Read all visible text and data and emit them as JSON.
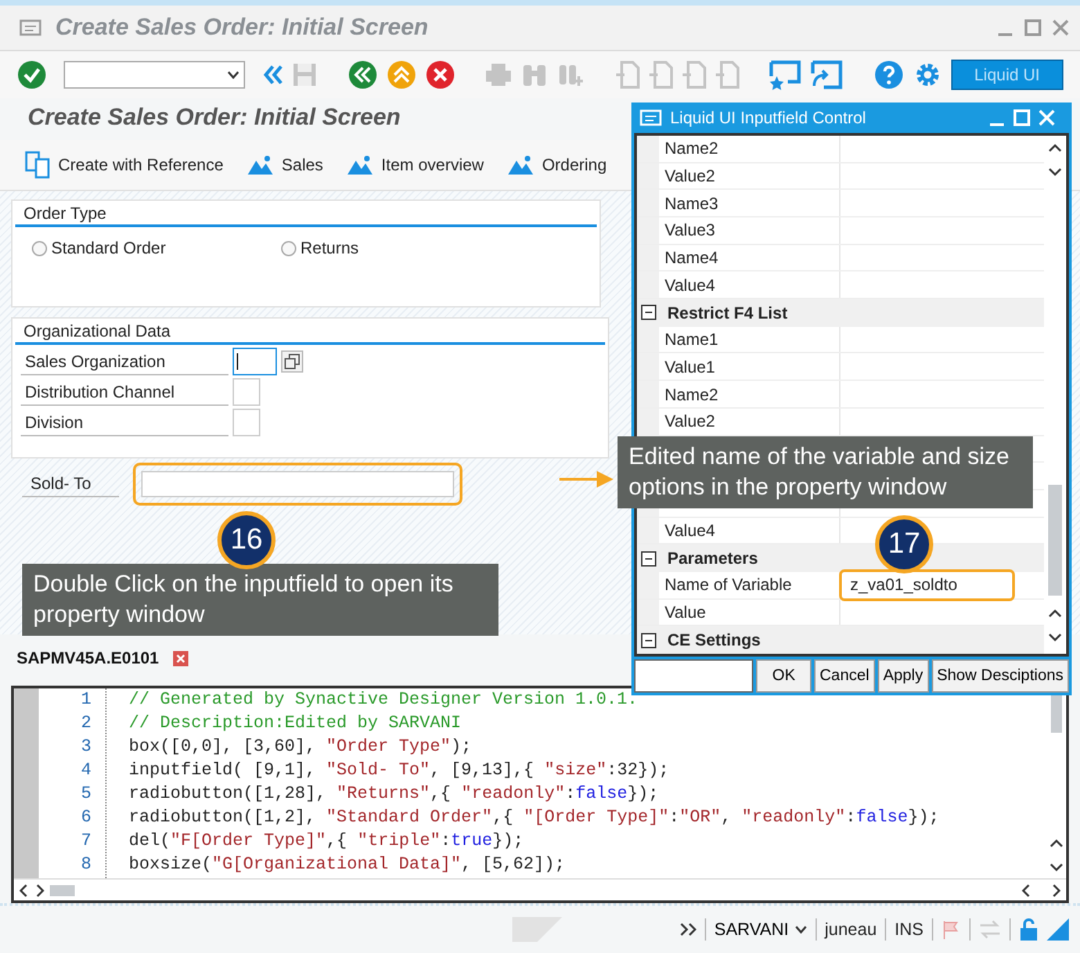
{
  "window": {
    "title": "Create Sales Order: Initial Screen"
  },
  "toolbar": {
    "liquid_ui_button": "Liquid UI"
  },
  "screen_title": "Create Sales Order: Initial Screen",
  "app_toolbar": [
    {
      "label": "Create with Reference",
      "kind": "reference"
    },
    {
      "label": "Sales",
      "kind": "mountain"
    },
    {
      "label": "Item overview",
      "kind": "mountain"
    },
    {
      "label": "Ordering",
      "kind": "mountain"
    }
  ],
  "order_type": {
    "title": "Order Type",
    "radios": [
      {
        "label": "Standard Order",
        "selected": false
      },
      {
        "label": "Returns",
        "selected": false
      }
    ]
  },
  "organizational_data": {
    "title": "Organizational Data",
    "fields": [
      {
        "label": "Sales Organization",
        "focused": true
      },
      {
        "label": "Distribution Channel",
        "focused": false
      },
      {
        "label": "Division",
        "focused": false
      }
    ]
  },
  "sold_to": {
    "label": "Sold- To"
  },
  "editor": {
    "tabs": [
      {
        "label": "SAPMV45A.E0101",
        "selected": true
      }
    ],
    "lines": [
      {
        "number": "1",
        "tokens": [
          {
            "kind": "comment",
            "text": "// Generated by Synactive Designer Version 1.0.1."
          }
        ]
      },
      {
        "number": "2",
        "tokens": [
          {
            "kind": "comment",
            "text": "// Description:Edited by SARVANI"
          }
        ]
      },
      {
        "number": "3",
        "tokens": [
          {
            "kind": "plain",
            "text": "box([0,0], [3,60], "
          },
          {
            "kind": "string",
            "text": "\"Order Type\""
          },
          {
            "kind": "plain",
            "text": ");"
          }
        ]
      },
      {
        "number": "4",
        "tokens": [
          {
            "kind": "plain",
            "text": "inputfield( [9,1], "
          },
          {
            "kind": "string",
            "text": "\"Sold- To\""
          },
          {
            "kind": "plain",
            "text": ", [9,13],{ "
          },
          {
            "kind": "string",
            "text": "\"size\""
          },
          {
            "kind": "plain",
            "text": ":32});"
          }
        ]
      },
      {
        "number": "5",
        "tokens": [
          {
            "kind": "plain",
            "text": "radiobutton([1,28], "
          },
          {
            "kind": "string",
            "text": "\"Returns\""
          },
          {
            "kind": "plain",
            "text": ",{ "
          },
          {
            "kind": "string",
            "text": "\"readonly\""
          },
          {
            "kind": "plain",
            "text": ":"
          },
          {
            "kind": "keyword",
            "text": "false"
          },
          {
            "kind": "plain",
            "text": "});"
          }
        ]
      },
      {
        "number": "6",
        "tokens": [
          {
            "kind": "plain",
            "text": "radiobutton([1,2], "
          },
          {
            "kind": "string",
            "text": "\"Standard Order\""
          },
          {
            "kind": "plain",
            "text": ",{ "
          },
          {
            "kind": "string",
            "text": "\"[Order Type]\""
          },
          {
            "kind": "plain",
            "text": ":"
          },
          {
            "kind": "string",
            "text": "\"OR\""
          },
          {
            "kind": "plain",
            "text": ", "
          },
          {
            "kind": "string",
            "text": "\"readonly\""
          },
          {
            "kind": "plain",
            "text": ":"
          },
          {
            "kind": "keyword",
            "text": "false"
          },
          {
            "kind": "plain",
            "text": "});"
          }
        ]
      },
      {
        "number": "7",
        "tokens": [
          {
            "kind": "plain",
            "text": "del("
          },
          {
            "kind": "string",
            "text": "\"F[Order Type]\""
          },
          {
            "kind": "plain",
            "text": ",{ "
          },
          {
            "kind": "string",
            "text": "\"triple\""
          },
          {
            "kind": "plain",
            "text": ":"
          },
          {
            "kind": "keyword",
            "text": "true"
          },
          {
            "kind": "plain",
            "text": "});"
          }
        ]
      },
      {
        "number": "8",
        "tokens": [
          {
            "kind": "plain",
            "text": "boxsize("
          },
          {
            "kind": "string",
            "text": "\"G[Organizational Data]\""
          },
          {
            "kind": "plain",
            "text": ", [5,62]);"
          }
        ]
      }
    ]
  },
  "status_bar": {
    "user": "SARVANI",
    "server": "juneau",
    "mode": "INS"
  },
  "dialog": {
    "title": "Liquid UI Inputfield Control",
    "rows": [
      {
        "kind": "row",
        "name": "Name2"
      },
      {
        "kind": "row",
        "name": "Value2"
      },
      {
        "kind": "row",
        "name": "Name3"
      },
      {
        "kind": "row",
        "name": "Value3"
      },
      {
        "kind": "row",
        "name": "Name4"
      },
      {
        "kind": "row",
        "name": "Value4"
      },
      {
        "kind": "section",
        "name": "Restrict F4 List",
        "expanded": true
      },
      {
        "kind": "row",
        "name": "Name1"
      },
      {
        "kind": "row",
        "name": "Value1"
      },
      {
        "kind": "row",
        "name": "Name2"
      },
      {
        "kind": "row",
        "name": "Value2"
      },
      {
        "kind": "row"
      },
      {
        "kind": "row"
      },
      {
        "kind": "row"
      },
      {
        "kind": "row",
        "name": "Value4"
      },
      {
        "kind": "section",
        "name": "Parameters",
        "expanded": true
      },
      {
        "kind": "row",
        "name": "Name of Variable",
        "value": "z_va01_soldto",
        "highlighted": true
      },
      {
        "kind": "row",
        "name": "Value"
      },
      {
        "kind": "section",
        "name": "CE Settings",
        "expanded": true
      }
    ],
    "buttons": [
      "OK",
      "Cancel",
      "Apply",
      "Show Desciptions"
    ]
  },
  "callouts": [
    {
      "number": "16",
      "text": "Double Click on the inputfield to open its property window"
    },
    {
      "number": "17",
      "text": "Edited name of the variable and size options in the property window"
    }
  ]
}
